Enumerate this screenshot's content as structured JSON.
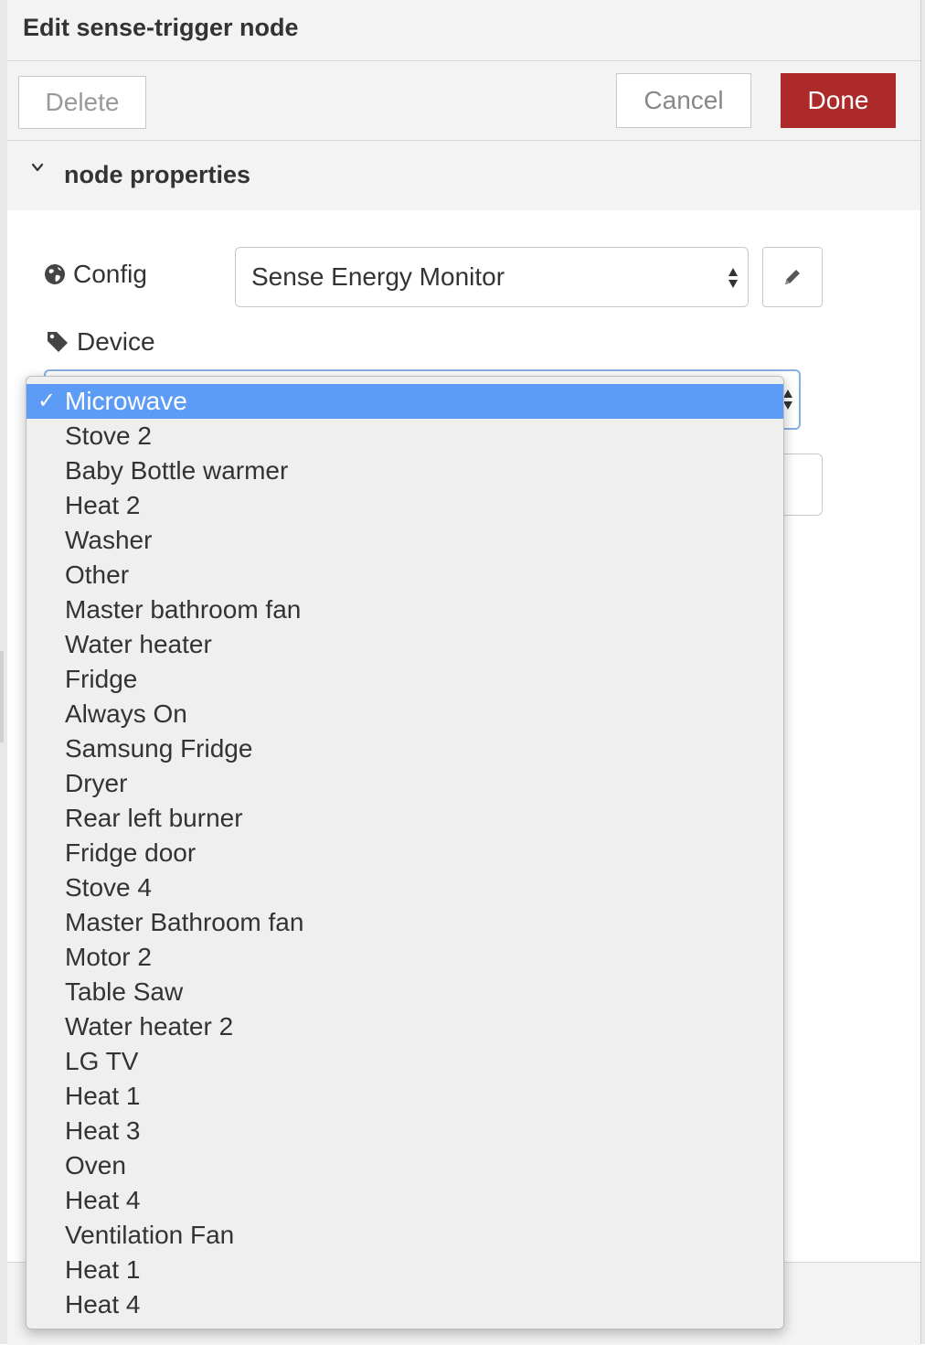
{
  "header": {
    "title": "Edit sense-trigger node"
  },
  "toolbar": {
    "delete_label": "Delete",
    "cancel_label": "Cancel",
    "done_label": "Done"
  },
  "section": {
    "title": "node properties"
  },
  "form": {
    "config_label": "Config",
    "config_value": "Sense Energy Monitor",
    "device_label": "Device"
  },
  "dropdown": {
    "selected_index": 0,
    "options": [
      "Microwave",
      "Stove 2",
      "Baby Bottle warmer",
      "Heat 2",
      "Washer",
      "Other",
      "Master bathroom fan",
      "Water heater",
      "Fridge",
      "Always On",
      "Samsung Fridge",
      "Dryer",
      "Rear left burner",
      "Fridge door",
      "Stove 4",
      "Master Bathroom fan",
      "Motor 2",
      "Table Saw",
      "Water heater 2",
      "LG TV",
      "Heat 1",
      "Heat 3",
      "Oven",
      "Heat 4",
      "Ventilation Fan",
      "Heat 1",
      "Heat 4"
    ]
  },
  "colors": {
    "done_button": "#ad2a2a",
    "selected_option": "#5d9cf6",
    "focus_border": "#85b0e0"
  },
  "icons": {
    "section_toggle": "chevron-down-icon",
    "config": "globe-icon",
    "device": "tag-icon",
    "edit": "pencil-icon",
    "select_arrows": "up-down-arrows-icon",
    "selected_mark": "checkmark-icon"
  }
}
